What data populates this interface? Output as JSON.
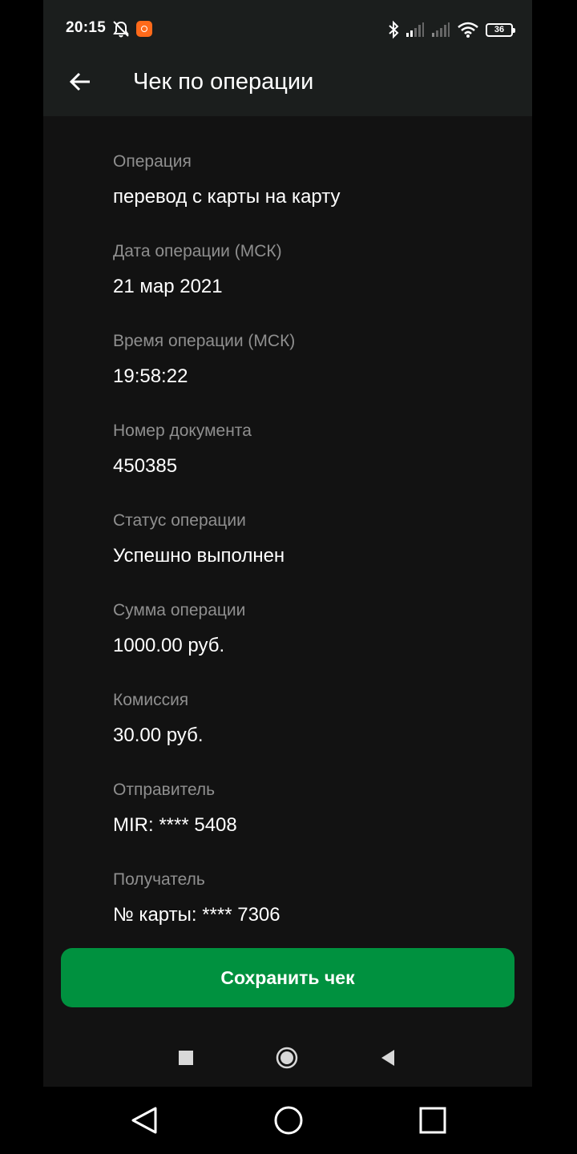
{
  "status_bar": {
    "time": "20:15",
    "battery": "36"
  },
  "header": {
    "title": "Чек по операции"
  },
  "receipt": [
    {
      "label": "Операция",
      "value": "перевод с карты на карту"
    },
    {
      "label": "Дата операции (МСК)",
      "value": "21 мар 2021"
    },
    {
      "label": "Время операции (МСК)",
      "value": "19:58:22"
    },
    {
      "label": "Номер документа",
      "value": "450385"
    },
    {
      "label": "Статус операции",
      "value": "Успешно выполнен"
    },
    {
      "label": "Сумма операции",
      "value": "1000.00 руб."
    },
    {
      "label": "Комиссия",
      "value": "30.00 руб."
    },
    {
      "label": "Отправитель",
      "value": "MIR: **** 5408"
    },
    {
      "label": "Получатель",
      "value": "№ карты: **** 7306"
    }
  ],
  "actions": {
    "save_label": "Сохранить чек"
  },
  "colors": {
    "accent": "#00913f",
    "background": "#121212",
    "appbar": "#1b1e1d",
    "label": "#8f8f8f",
    "text": "#ffffff"
  },
  "icons": {
    "back": "arrow-left-icon",
    "alarm_off": "alarm-off-icon",
    "app_notification": "app-notification-icon",
    "bluetooth": "bluetooth-icon",
    "signal": "cellular-signal-icon",
    "wifi": "wifi-icon",
    "battery": "battery-icon",
    "inner_recents": "square-icon",
    "inner_home": "circle-icon",
    "inner_back": "triangle-back-icon",
    "nav_back": "nav-back-icon",
    "nav_home": "nav-home-icon",
    "nav_recents": "nav-recents-icon"
  }
}
